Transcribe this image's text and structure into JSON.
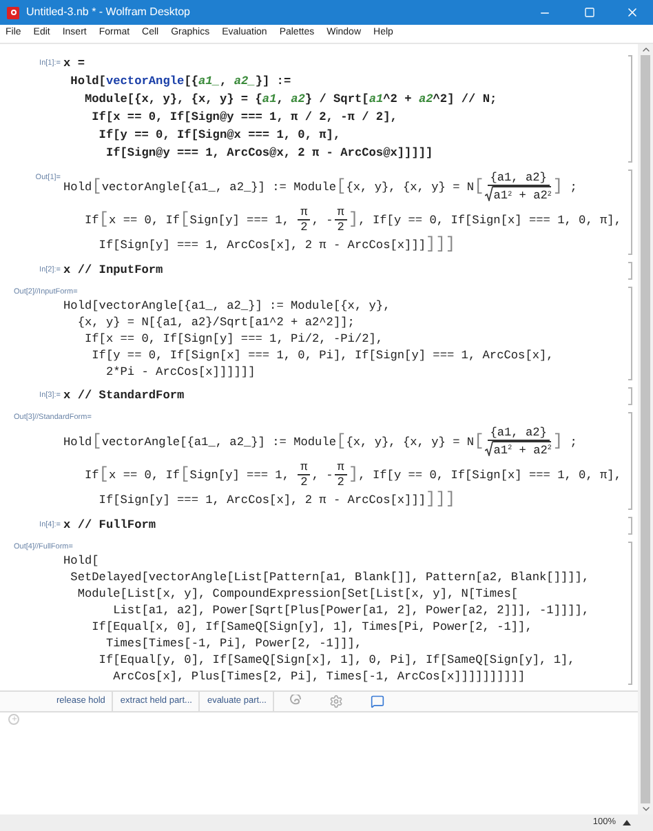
{
  "window": {
    "title": "Untitled-3.nb * - Wolfram Desktop"
  },
  "menu": [
    {
      "label": "File"
    },
    {
      "label": "Edit"
    },
    {
      "label": "Insert"
    },
    {
      "label": "Format"
    },
    {
      "label": "Cell"
    },
    {
      "label": "Graphics"
    },
    {
      "label": "Evaluation"
    },
    {
      "label": "Palettes"
    },
    {
      "label": "Window"
    },
    {
      "label": "Help"
    }
  ],
  "cells": [
    {
      "kind": "input",
      "label": "In[1]:=",
      "label_inline": true,
      "lines": [
        "x =",
        [
          " Hold[",
          {
            "kind": "symbol",
            "text": "vectorAngle"
          },
          "[{",
          {
            "kind": "pattern",
            "text": "a1_"
          },
          ", ",
          {
            "kind": "pattern",
            "text": "a2_"
          },
          "}] :="
        ],
        [
          "   Module[{x, y}, {x, y} = {",
          {
            "kind": "pattern",
            "text": "a1"
          },
          ", ",
          {
            "kind": "pattern",
            "text": "a2"
          },
          "} / Sqrt[",
          {
            "kind": "pattern",
            "text": "a1"
          },
          "^2 + ",
          {
            "kind": "pattern",
            "text": "a2"
          },
          "^2] // N;"
        ],
        "    If[x == 0, If[Sign@y === 1, π / 2, -π / 2],",
        "     If[y == 0, If[Sign@x === 1, 0, π],",
        "      If[Sign@y === 1, ArcCos@x, 2 π - ArcCos@x]]]]]"
      ]
    },
    {
      "kind": "output",
      "label": "Out[1]=",
      "label_inline": true,
      "lines": [
        [
          "Hold",
          {
            "kind": "big",
            "text": "["
          },
          "vectorAngle[{a1_, a2_}] := Module",
          {
            "kind": "big",
            "text": "["
          },
          "{x, y}, {x, y} = N",
          {
            "kind": "big",
            "text": "["
          },
          {
            "kind": "frac",
            "num": "{a1, a2}",
            "den": "a1$^{2}$ + a2$^{2}$",
            "sqrt": true
          },
          {
            "kind": "big",
            "text": "]"
          },
          " ;"
        ],
        [
          "   If",
          {
            "kind": "big",
            "text": "["
          },
          "x == 0, If",
          {
            "kind": "big",
            "text": "["
          },
          "Sign[y] === 1, ",
          {
            "kind": "frac",
            "num": "π",
            "den": "2",
            "sqrt": false
          },
          ", -",
          {
            "kind": "frac",
            "num": "π",
            "den": "2",
            "sqrt": false
          },
          {
            "kind": "big",
            "text": "]"
          },
          ", If[y == 0, If[Sign[x] === 1, 0, π],"
        ],
        [
          "     If[Sign[y] === 1, ArcCos[x], 2 π - ArcCos[x]]]",
          {
            "kind": "big",
            "text": "]"
          },
          {
            "kind": "big",
            "text": "]"
          },
          {
            "kind": "big",
            "text": "]"
          }
        ]
      ]
    },
    {
      "kind": "input",
      "label": "In[2]:=",
      "label_inline": true,
      "lines": [
        "x // InputForm"
      ]
    },
    {
      "kind": "output",
      "label": "Out[2]//InputForm=",
      "label_inline": false,
      "lines": [
        "Hold[vectorAngle[{a1_, a2_}] := Module[{x, y},",
        "  {x, y} = N[{a1, a2}/Sqrt[a1^2 + a2^2]];",
        "   If[x == 0, If[Sign[y] === 1, Pi/2, -Pi/2],",
        "    If[y == 0, If[Sign[x] === 1, 0, Pi], If[Sign[y] === 1, ArcCos[x],",
        "      2*Pi - ArcCos[x]]]]]]"
      ]
    },
    {
      "kind": "input",
      "label": "In[3]:=",
      "label_inline": true,
      "lines": [
        "x // StandardForm"
      ]
    },
    {
      "kind": "output",
      "label": "Out[3]//StandardForm=",
      "label_inline": false,
      "lines": [
        [
          "Hold",
          {
            "kind": "big",
            "text": "["
          },
          "vectorAngle[{a1_, a2_}] := Module",
          {
            "kind": "big",
            "text": "["
          },
          "{x, y}, {x, y} = N",
          {
            "kind": "big",
            "text": "["
          },
          {
            "kind": "frac",
            "num": "{a1, a2}",
            "den": "a1$^{2}$ + a2$^{2}$",
            "sqrt": true
          },
          {
            "kind": "big",
            "text": "]"
          },
          " ;"
        ],
        [
          "   If",
          {
            "kind": "big",
            "text": "["
          },
          "x == 0, If",
          {
            "kind": "big",
            "text": "["
          },
          "Sign[y] === 1, ",
          {
            "kind": "frac",
            "num": "π",
            "den": "2",
            "sqrt": false
          },
          ", -",
          {
            "kind": "frac",
            "num": "π",
            "den": "2",
            "sqrt": false
          },
          {
            "kind": "big",
            "text": "]"
          },
          ", If[y == 0, If[Sign[x] === 1, 0, π],"
        ],
        [
          "     If[Sign[y] === 1, ArcCos[x], 2 π - ArcCos[x]]]",
          {
            "kind": "big",
            "text": "]"
          },
          {
            "kind": "big",
            "text": "]"
          },
          {
            "kind": "big",
            "text": "]"
          }
        ]
      ]
    },
    {
      "kind": "input",
      "label": "In[4]:=",
      "label_inline": true,
      "lines": [
        "x // FullForm"
      ]
    },
    {
      "kind": "output",
      "label": "Out[4]//FullForm=",
      "label_inline": false,
      "lines": [
        "Hold[",
        " SetDelayed[vectorAngle[List[Pattern[a1, Blank[]], Pattern[a2, Blank[]]]],",
        "  Module[List[x, y], CompoundExpression[Set[List[x, y], N[Times[",
        "       List[a1, a2], Power[Sqrt[Plus[Power[a1, 2], Power[a2, 2]]], -1]]]],",
        "    If[Equal[x, 0], If[SameQ[Sign[y], 1], Times[Pi, Power[2, -1]],",
        "      Times[Times[-1, Pi], Power[2, -1]]],",
        "     If[Equal[y, 0], If[SameQ[Sign[x], 1], 0, Pi], If[SameQ[Sign[y], 1],",
        "       ArcCos[x], Plus[Times[2, Pi], Times[-1, ArcCos[x]]]]]]]]]]"
      ]
    }
  ],
  "suggestions": [
    {
      "kind": "text",
      "label": "release hold"
    },
    {
      "kind": "text",
      "label": "extract held part..."
    },
    {
      "kind": "text",
      "label": "evaluate part..."
    },
    {
      "kind": "swirl"
    },
    {
      "kind": "gear"
    },
    {
      "kind": "chat"
    }
  ],
  "status_bar": {
    "zoom": "100%"
  }
}
